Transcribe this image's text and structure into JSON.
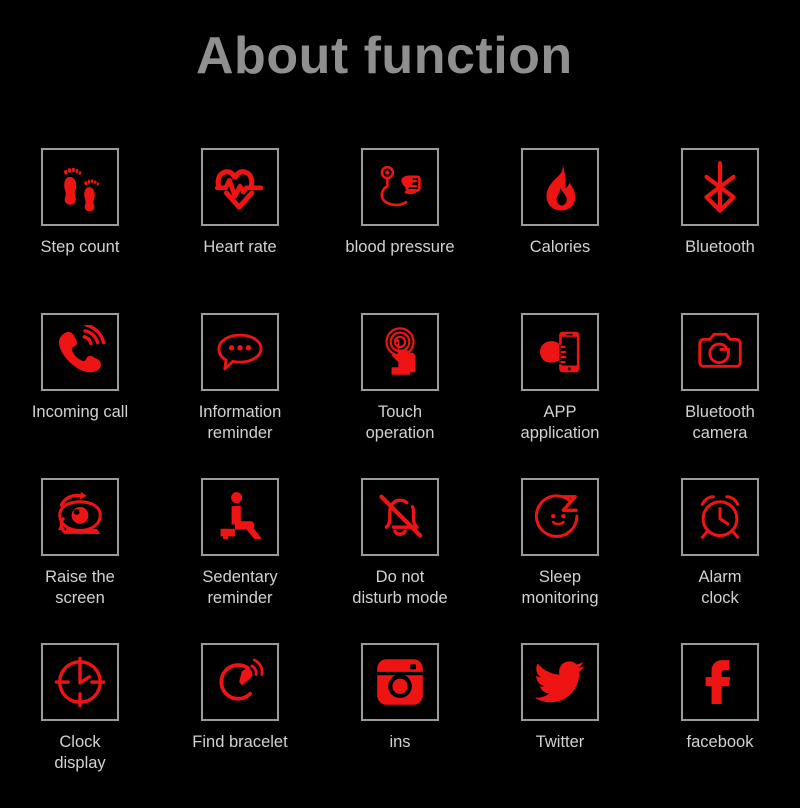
{
  "page": {
    "title": "About function",
    "background_color": "#000000",
    "title_color": "#8f8f8f",
    "label_color": "#d2d2d2",
    "icon_color": "#ee1414",
    "icon_border_color": "#9b9b9b"
  },
  "grid": {
    "columns": 5,
    "rows": 4,
    "items": [
      {
        "label": "Step count",
        "icon": "footprints-icon"
      },
      {
        "label": "Heart rate",
        "icon": "heart-pulse-icon"
      },
      {
        "label": "blood pressure",
        "icon": "blood-pressure-icon"
      },
      {
        "label": "Calories",
        "icon": "flame-icon"
      },
      {
        "label": "Bluetooth",
        "icon": "bluetooth-icon"
      },
      {
        "label": "Incoming call",
        "icon": "phone-ringing-icon"
      },
      {
        "label": "Information\nreminder",
        "icon": "chat-bubble-icon"
      },
      {
        "label": "Touch\noperation",
        "icon": "touch-hand-icon"
      },
      {
        "label": "APP\napplication",
        "icon": "hand-phone-icon"
      },
      {
        "label": "Bluetooth\ncamera",
        "icon": "camera-icon"
      },
      {
        "label": "Raise the\nscreen",
        "icon": "raise-eye-icon"
      },
      {
        "label": "Sedentary\nreminder",
        "icon": "seated-person-icon"
      },
      {
        "label": "Do not\ndisturb mode",
        "icon": "bell-muted-icon"
      },
      {
        "label": "Sleep\nmonitoring",
        "icon": "sleep-face-icon"
      },
      {
        "label": "Alarm\nclock",
        "icon": "alarm-clock-icon"
      },
      {
        "label": "Clock\ndisplay",
        "icon": "clock-face-icon"
      },
      {
        "label": "Find bracelet",
        "icon": "bracelet-signal-icon"
      },
      {
        "label": "ins",
        "icon": "instagram-icon"
      },
      {
        "label": "Twitter",
        "icon": "twitter-bird-icon"
      },
      {
        "label": "facebook",
        "icon": "facebook-f-icon"
      }
    ]
  }
}
